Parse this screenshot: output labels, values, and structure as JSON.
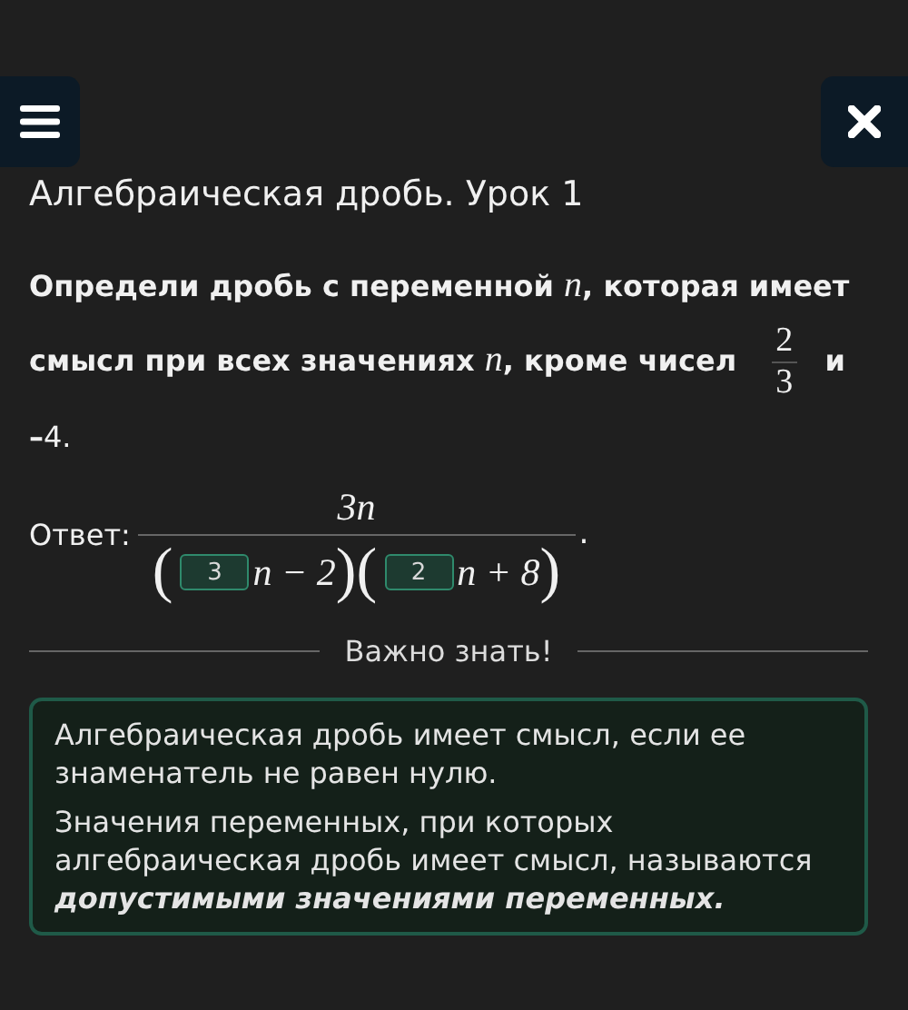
{
  "header": {
    "title": "Алгебраическая дробь. Урок 1"
  },
  "question": [
    {
      "kind": "text",
      "text": "Определи дробь с переменной "
    },
    {
      "kind": "var",
      "text": "n"
    },
    {
      "kind": "text",
      "text": ", которая имеет смысл при всех значениях "
    },
    {
      "kind": "var",
      "text": "n"
    },
    {
      "kind": "text",
      "text": ", кроме чисел "
    },
    {
      "kind": "frac",
      "num": "2",
      "den": "3"
    },
    {
      "kind": "text",
      "text": " и –"
    },
    {
      "kind": "plain",
      "text": "4."
    }
  ],
  "answer": {
    "label": "Ответ:",
    "numerator": "3n",
    "factors": [
      {
        "open": "(",
        "value": "3",
        "rest": "n − 2",
        "close": ")"
      },
      {
        "open": "(",
        "value": "2",
        "rest": "n + 8",
        "close": ")"
      }
    ],
    "end": "."
  },
  "divider": {
    "label": "Важно знать!"
  },
  "info": [
    "Алгебраическая дробь имеет смысл, если ее знаменатель не равен нулю.",
    "Значения переменных, при которых алгебраическая дробь имеет смысл, называются **допустимыми значениями переменных.**"
  ]
}
